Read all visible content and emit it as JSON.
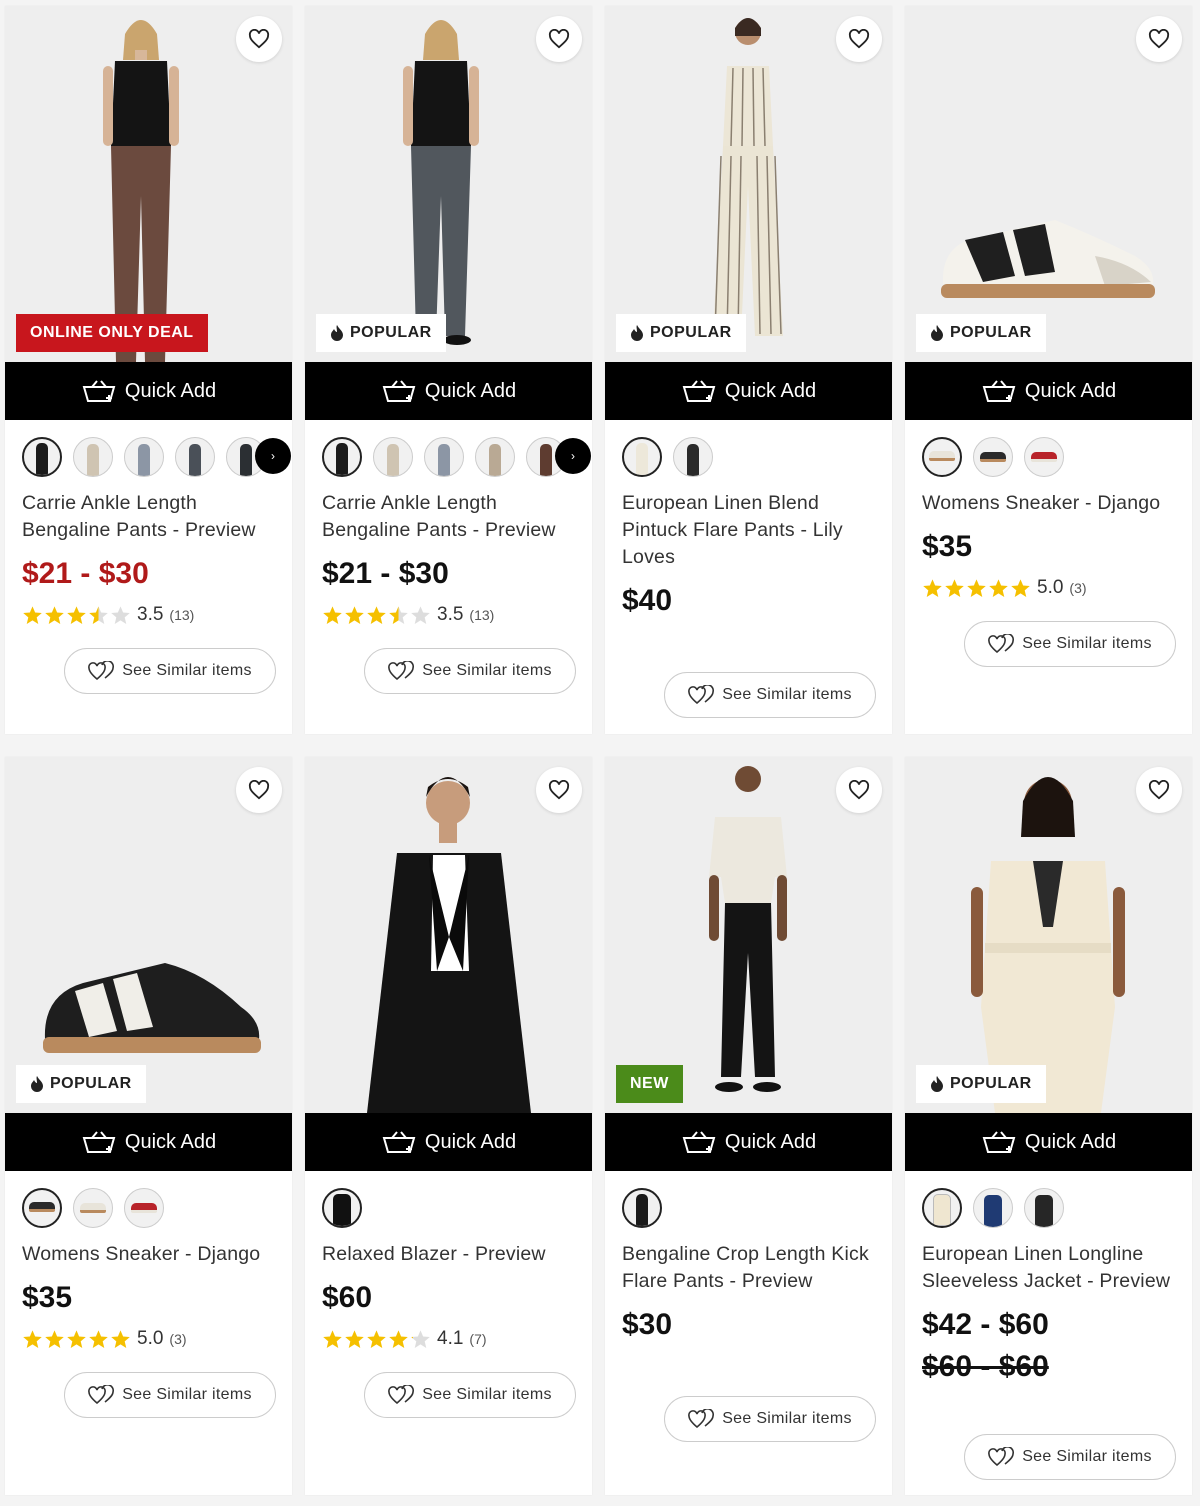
{
  "common": {
    "quick_add_label": "Quick Add",
    "see_similar_label": "See Similar items",
    "icons": {
      "favorite": "heart-outline-icon",
      "quick_add": "basket-add-icon",
      "similar": "hearts-icon",
      "popular": "flame-icon",
      "rating": "star-icon"
    },
    "colors": {
      "sale_price": "#b01a1a",
      "deal_badge": "#c8161d",
      "new_badge": "#4b8b1a",
      "star": "#f5c000",
      "quick_add_bg": "#000000"
    }
  },
  "products": [
    {
      "name": "Carrie Ankle Length Bengaline Pants - Preview",
      "badge": "ONLINE ONLY DEAL",
      "badge_type": "deal",
      "price": "$21 - $30",
      "price_sale": true,
      "rating": 3.5,
      "rating_text": "3.5",
      "review_count": "(13)",
      "swatch_colors": [
        "#1b1b1b",
        "#cfc4b2",
        "#8c96a5",
        "#4a5058",
        "#2b2f33"
      ],
      "more_swatches": true
    },
    {
      "name": "Carrie Ankle Length Bengaline Pants - Preview",
      "badge": "POPULAR",
      "badge_type": "popular",
      "price": "$21 - $30",
      "price_sale": false,
      "rating": 3.5,
      "rating_text": "3.5",
      "review_count": "(13)",
      "swatch_colors": [
        "#1b1b1b",
        "#cfc4b2",
        "#8c96a5",
        "#b9a994",
        "#5e3c30"
      ],
      "more_swatches": true
    },
    {
      "name": "European Linen Blend Pintuck Flare Pants - Lily Loves",
      "badge": "POPULAR",
      "badge_type": "popular",
      "price": "$40",
      "price_sale": false,
      "swatch_colors": [
        "#ede8da",
        "#2a2a2a"
      ],
      "more_swatches": false
    },
    {
      "name": "Womens Sneaker - Django",
      "badge": "POPULAR",
      "badge_type": "popular",
      "price": "$35",
      "price_sale": false,
      "rating": 5.0,
      "rating_text": "5.0",
      "review_count": "(3)",
      "swatch_colors": [
        "#f0efea",
        "#2a2a2a",
        "#b8232a"
      ],
      "more_swatches": false
    },
    {
      "name": "Womens Sneaker - Django",
      "badge": "POPULAR",
      "badge_type": "popular",
      "price": "$35",
      "price_sale": false,
      "rating": 5.0,
      "rating_text": "5.0",
      "review_count": "(3)",
      "swatch_colors": [
        "#2a2a2a",
        "#f0efea",
        "#b8232a"
      ],
      "more_swatches": false
    },
    {
      "name": "Relaxed Blazer - Preview",
      "badge": "",
      "badge_type": "none",
      "price": "$60",
      "price_sale": false,
      "rating": 4.1,
      "rating_text": "4.1",
      "review_count": "(7)",
      "swatch_colors": [
        "#111111"
      ],
      "more_swatches": false
    },
    {
      "name": "Bengaline Crop Length Kick Flare Pants - Preview",
      "badge": "NEW",
      "badge_type": "new",
      "price": "$30",
      "price_sale": false,
      "swatch_colors": [
        "#1a1a1a"
      ],
      "more_swatches": false
    },
    {
      "name": "European Linen Longline Sleeveless Jacket - Preview",
      "badge": "POPULAR",
      "badge_type": "popular",
      "price": "$42 - $60",
      "price_sale": false,
      "was_price": "$60 - $60",
      "swatch_colors": [
        "#efe6d0",
        "#1f3a73",
        "#262626"
      ],
      "more_swatches": false
    }
  ]
}
